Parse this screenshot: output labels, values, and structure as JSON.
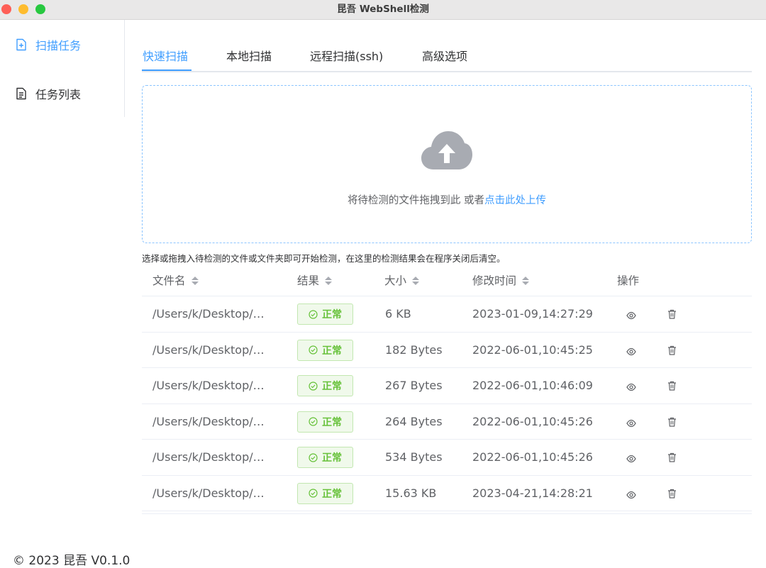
{
  "window": {
    "title": "昆吾 WebShell检测"
  },
  "sidebar": {
    "items": [
      {
        "label": "扫描任务",
        "icon": "document-add-icon",
        "active": true
      },
      {
        "label": "任务列表",
        "icon": "document-list-icon",
        "active": false
      }
    ]
  },
  "tabs": [
    {
      "label": "快速扫描",
      "active": true
    },
    {
      "label": "本地扫描",
      "active": false
    },
    {
      "label": "远程扫描(ssh)",
      "active": false
    },
    {
      "label": "高级选项",
      "active": false
    }
  ],
  "upload": {
    "icon": "cloud-upload-icon",
    "text": "将待检测的文件拖拽到此 或者",
    "link": "点击此处上传"
  },
  "hint": "选择或拖拽入待检测的文件或文件夹即可开始检测，在这里的检测结果会在程序关闭后清空。",
  "table": {
    "columns": [
      {
        "label": "文件名",
        "sortable": true
      },
      {
        "label": "结果",
        "sortable": true
      },
      {
        "label": "大小",
        "sortable": true
      },
      {
        "label": "修改时间",
        "sortable": true
      },
      {
        "label": "操作",
        "sortable": false
      }
    ],
    "rows": [
      {
        "path": "/Users/k/Desktop/…",
        "result": "正常",
        "size": "6 KB",
        "modified": "2023-01-09,14:27:29"
      },
      {
        "path": "/Users/k/Desktop/…",
        "result": "正常",
        "size": "182 Bytes",
        "modified": "2022-06-01,10:45:25"
      },
      {
        "path": "/Users/k/Desktop/…",
        "result": "正常",
        "size": "267 Bytes",
        "modified": "2022-06-01,10:46:09"
      },
      {
        "path": "/Users/k/Desktop/…",
        "result": "正常",
        "size": "264 Bytes",
        "modified": "2022-06-01,10:45:26"
      },
      {
        "path": "/Users/k/Desktop/…",
        "result": "正常",
        "size": "534 Bytes",
        "modified": "2022-06-01,10:45:26"
      },
      {
        "path": "/Users/k/Desktop/…",
        "result": "正常",
        "size": "15.63 KB",
        "modified": "2023-04-21,14:28:21"
      }
    ],
    "row_actions": [
      "view-icon",
      "trash-icon"
    ]
  },
  "footer": "© 2023 昆吾 V0.1.0",
  "colors": {
    "accent": "#409eff",
    "success": "#67c23a",
    "success_bg": "#f0f9eb",
    "text": "#303133",
    "muted": "#606266"
  }
}
